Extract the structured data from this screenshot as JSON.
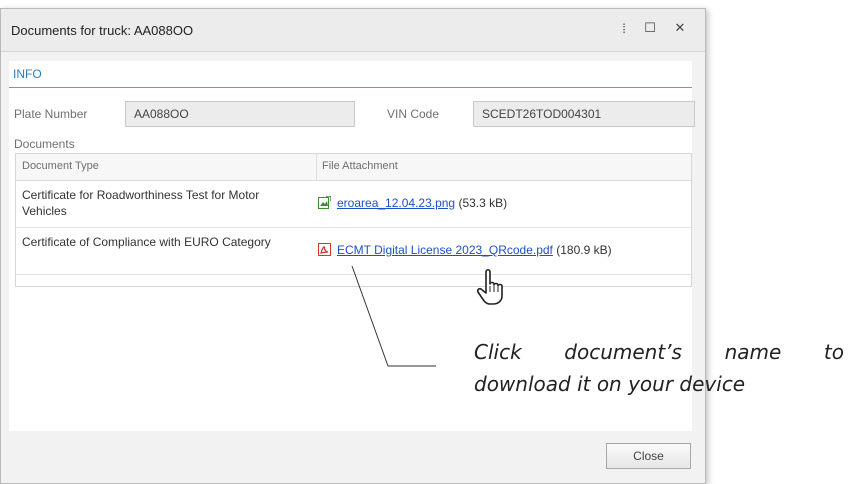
{
  "window": {
    "title": "Documents for truck: AA088OO",
    "pin_glyph": "⁞",
    "maximize_glyph": "☐",
    "close_glyph": "✕"
  },
  "info": {
    "tab_label": "INFO",
    "plate_label": "Plate Number",
    "plate_value": "AA088OO",
    "vin_label": "VIN Code",
    "vin_value": "SCEDT26TOD004301",
    "documents_label": "Documents"
  },
  "grid": {
    "columns": [
      "Document Type",
      "File Attachment"
    ],
    "rows": [
      {
        "type": "Certificate for Roadworthiness Test for Motor Vehicles",
        "file_name": "eroarea_12.04.23.png",
        "file_size": "(53.3 kB)",
        "icon": "image-file-icon"
      },
      {
        "type": "Certificate of Compliance with EURO Category",
        "file_name": "ECMT Digital License 2023_QRcode.pdf",
        "file_size": "(180.9 kB)",
        "icon": "pdf-file-icon"
      }
    ]
  },
  "footer": {
    "close_label": "Close"
  },
  "callout": {
    "words_line1": [
      "Click",
      "document’s",
      "name",
      "to"
    ],
    "line2": "download it on your device"
  },
  "colors": {
    "accent": "#2b7ec1",
    "link": "#1f4fc7",
    "pdf_icon": "#d9342b",
    "image_icon": "#3a8f2a"
  }
}
